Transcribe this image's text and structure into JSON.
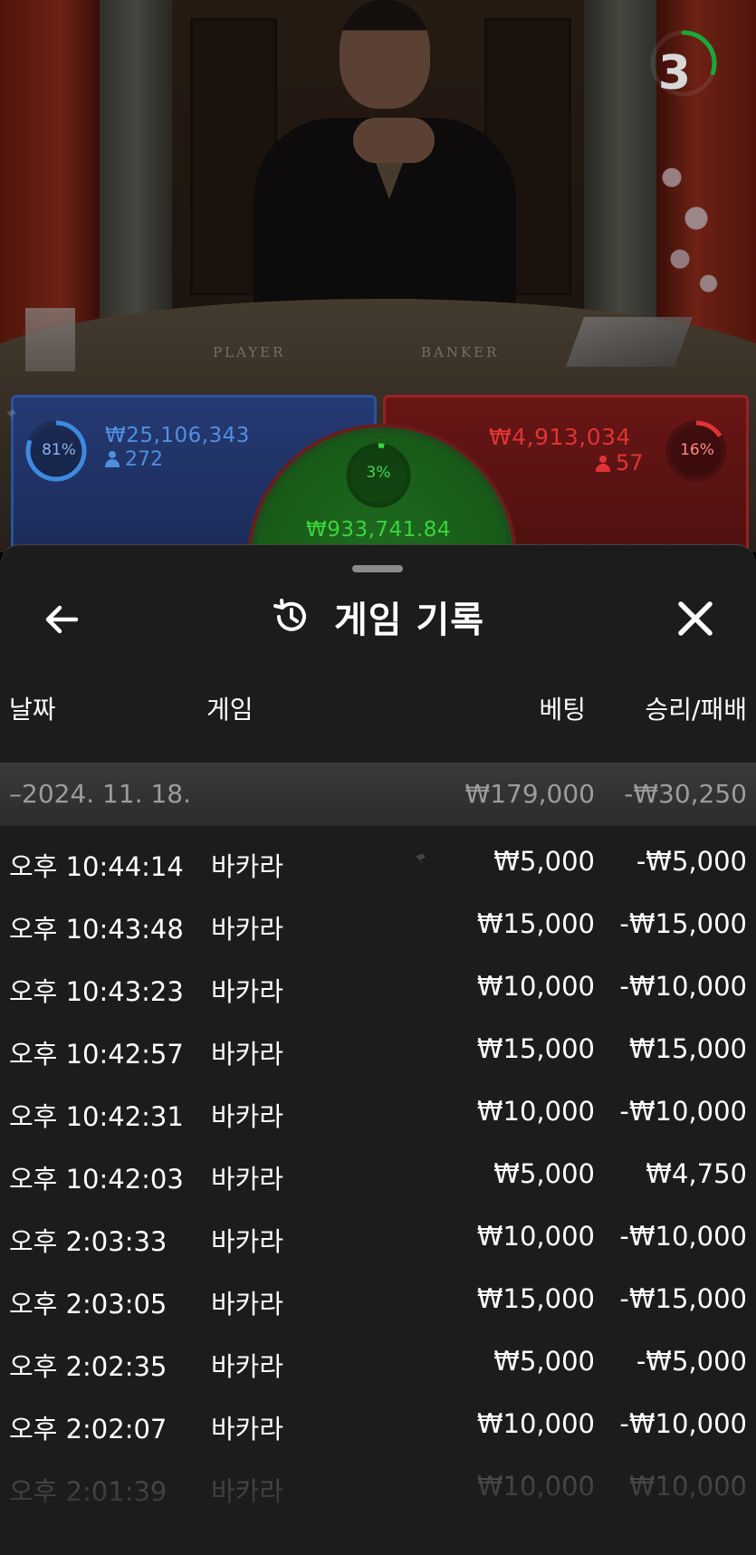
{
  "video": {
    "table_labels": [
      "PLAYER",
      "BANKER"
    ],
    "countdown": "3",
    "countdown_fraction": 0.3
  },
  "bets": {
    "player": {
      "percent": "81%",
      "percent_value": 0.81,
      "amount": "₩25,106,343",
      "count": "272",
      "color": "#2a56a8"
    },
    "banker": {
      "percent": "16%",
      "percent_value": 0.16,
      "amount": "₩4,913,034",
      "count": "57",
      "color": "#a32121"
    },
    "tie": {
      "percent": "3%",
      "percent_value": 0.03,
      "amount": "₩933,741.84",
      "color": "#1f6b1f"
    }
  },
  "sheet": {
    "title": "게임 기록",
    "back_icon": "arrow-left-icon",
    "history_icon": "history-clock-icon",
    "close_icon": "close-icon",
    "columns": {
      "date": "날짜",
      "game": "게임",
      "bet": "베팅",
      "win_loss": "승리/패배"
    },
    "summary": {
      "date": "–2024. 11. 18.",
      "bet": "₩179,000",
      "win_loss": "-₩30,250"
    },
    "rows": [
      {
        "time": "오후 10:44:14",
        "game": "바카라",
        "bet": "₩5,000",
        "win_loss": "-₩5,000"
      },
      {
        "time": "오후 10:43:48",
        "game": "바카라",
        "bet": "₩15,000",
        "win_loss": "-₩15,000"
      },
      {
        "time": "오후 10:43:23",
        "game": "바카라",
        "bet": "₩10,000",
        "win_loss": "-₩10,000"
      },
      {
        "time": "오후 10:42:57",
        "game": "바카라",
        "bet": "₩15,000",
        "win_loss": "₩15,000"
      },
      {
        "time": "오후 10:42:31",
        "game": "바카라",
        "bet": "₩10,000",
        "win_loss": "-₩10,000"
      },
      {
        "time": "오후 10:42:03",
        "game": "바카라",
        "bet": "₩5,000",
        "win_loss": "₩4,750"
      },
      {
        "time": "오후 2:03:33",
        "game": "바카라",
        "bet": "₩10,000",
        "win_loss": "-₩10,000"
      },
      {
        "time": "오후 2:03:05",
        "game": "바카라",
        "bet": "₩15,000",
        "win_loss": "-₩15,000"
      },
      {
        "time": "오후 2:02:35",
        "game": "바카라",
        "bet": "₩5,000",
        "win_loss": "-₩5,000"
      },
      {
        "time": "오후 2:02:07",
        "game": "바카라",
        "bet": "₩10,000",
        "win_loss": "-₩10,000"
      },
      {
        "time": "오후 2:01:39",
        "game": "바카라",
        "bet": "₩10,000",
        "win_loss": "₩10,000"
      }
    ]
  }
}
